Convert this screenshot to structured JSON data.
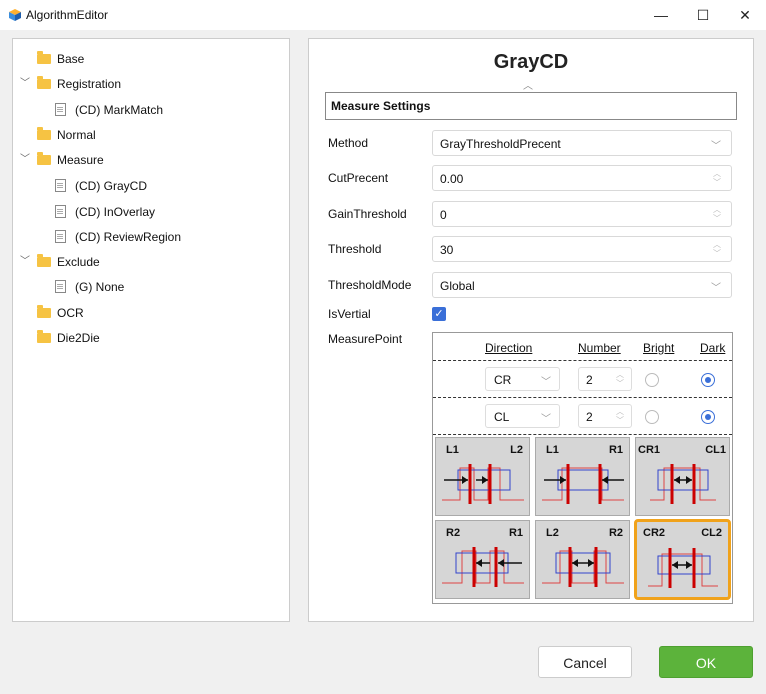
{
  "window": {
    "title": "AlgorithmEditor",
    "minimize": "—",
    "maximize": "☐",
    "close": "✕"
  },
  "tree": [
    {
      "label": "Base",
      "kind": "folder",
      "expanded": false
    },
    {
      "label": "Registration",
      "kind": "folder",
      "expanded": true
    },
    {
      "label": "(CD) MarkMatch",
      "kind": "item"
    },
    {
      "label": "Normal",
      "kind": "folder",
      "expanded": false
    },
    {
      "label": "Measure",
      "kind": "folder",
      "expanded": true
    },
    {
      "label": "(CD) GrayCD",
      "kind": "item"
    },
    {
      "label": "(CD) InOverlay",
      "kind": "item"
    },
    {
      "label": "(CD) ReviewRegion",
      "kind": "item"
    },
    {
      "label": "Exclude",
      "kind": "folder",
      "expanded": true
    },
    {
      "label": "(G) None",
      "kind": "item"
    },
    {
      "label": "OCR",
      "kind": "folder",
      "expanded": false
    },
    {
      "label": "Die2Die",
      "kind": "folder",
      "expanded": false
    }
  ],
  "main": {
    "title": "GrayCD",
    "section": "Measure Settings",
    "fields": {
      "method": {
        "label": "Method",
        "value": "GrayThresholdPrecent"
      },
      "cut_precent": {
        "label": "CutPrecent",
        "value": "0.00"
      },
      "gain_threshold": {
        "label": "GainThreshold",
        "value": "0"
      },
      "threshold": {
        "label": "Threshold",
        "value": "30"
      },
      "threshold_mode": {
        "label": "ThresholdMode",
        "value": "Global"
      },
      "is_vertial": {
        "label": "IsVertial",
        "checked": true
      },
      "measure_point": {
        "label": "MeasurePoint"
      }
    },
    "measure_table": {
      "headers": {
        "direction": "Direction",
        "number": "Number",
        "bright": "Bright",
        "dark": "Dark"
      },
      "rows": [
        {
          "direction": "CR",
          "number": "2",
          "selected": "dark"
        },
        {
          "direction": "CL",
          "number": "2",
          "selected": "dark"
        }
      ]
    },
    "tiles": [
      {
        "left": "L1",
        "right": "L2",
        "selected": false
      },
      {
        "left": "L1",
        "right": "R1",
        "selected": false
      },
      {
        "left": "CR1",
        "right": "CL1",
        "selected": false
      },
      {
        "left": "R2",
        "right": "R1",
        "selected": false
      },
      {
        "left": "L2",
        "right": "R2",
        "selected": false
      },
      {
        "left": "CR2",
        "right": "CL2",
        "selected": true
      }
    ]
  },
  "buttons": {
    "cancel": "Cancel",
    "ok": "OK"
  },
  "colors": {
    "accent": "#3a6fd8",
    "ok_button": "#5cb33b",
    "tile_selected": "#f0a21b"
  }
}
